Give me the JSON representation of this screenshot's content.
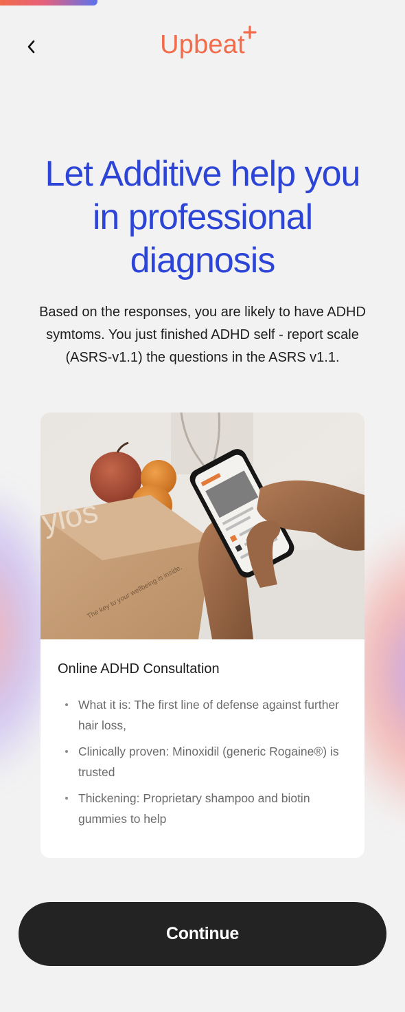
{
  "progress": {
    "fraction": 0.24
  },
  "header": {
    "back_icon": "chevron-left-icon",
    "logo_text": "Upbeat",
    "logo_plus_icon": "plus-icon",
    "brand_color": "#f26b4b"
  },
  "main": {
    "headline_line1": "Let Additive help you",
    "headline_line2": "in professional",
    "headline_line3": "diagnosis",
    "headline_color": "#2d45d6",
    "description_line1": "Based on the responses, you are likely to have ADHD",
    "description_line2": "symtoms. You just finished ADHD self - report scale",
    "description_line3": "(ASRS-v1.1) the questions in the ASRS v1.1."
  },
  "card": {
    "image_box_text": "ylos",
    "image_box_tagline": "The key to your wellbeing is inside.",
    "title": "Online ADHD Consultation",
    "items": [
      {
        "line1": "What it is: The first line of defense against further",
        "line2": "hair loss,"
      },
      {
        "line1": "Clinically proven: Minoxidil (generic Rogaine®) is",
        "line2": "trusted"
      },
      {
        "line1": "Thickening: Proprietary shampoo and biotin",
        "line2": "gummies to help"
      }
    ]
  },
  "footer": {
    "continue_label": "Continue"
  }
}
